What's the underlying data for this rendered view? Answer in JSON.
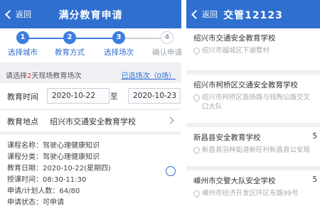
{
  "left": {
    "back_label": "返回",
    "title": "满分教育申请",
    "steps": [
      {
        "num": "1",
        "label": "选择城市"
      },
      {
        "num": "2",
        "label": "教育方式"
      },
      {
        "num": "3",
        "label": "选择场次"
      },
      {
        "num": "4",
        "label": "确认申请"
      }
    ],
    "hint_prefix": "请选择",
    "hint_number": "2",
    "hint_suffix": "天现场教育场次",
    "selected_link": "已选场次（0场）",
    "time_label": "教育时间",
    "date_from": "2020-10-22",
    "date_to_word": "至",
    "date_to": "2020-10-23",
    "place_label": "教育地点",
    "place_value": "绍兴市交通安全教育学校",
    "course": {
      "name": "课程名称：驾驶心理健康知识",
      "category": "课程分类：驾驶心理健康知识",
      "date": "教育日期：2020-10-22(星期四)",
      "time": "授课时间：08:30-11:30",
      "count": "申请/计划人数：64/80",
      "status": "申请状态：可申请"
    }
  },
  "right": {
    "back_label": "返回",
    "title": "交管12123",
    "items": [
      {
        "name": "绍兴市交通安全教育学校",
        "num": "",
        "address": "绍兴市越城区下谢墅村"
      },
      {
        "name": "绍兴市柯桥区交通安全教育学校",
        "num": "",
        "address": "绍兴市柯桥区笛扬路与钱陶公路交叉口大队"
      },
      {
        "name": "新昌县安全教育学校",
        "num": "5",
        "address": "新昌县羽林街道新旺村新昌县公安局"
      },
      {
        "name": "嵊州市交警大队安全学校",
        "num": "5",
        "address": "嵊州市经济开发区环区东路99号"
      }
    ]
  }
}
